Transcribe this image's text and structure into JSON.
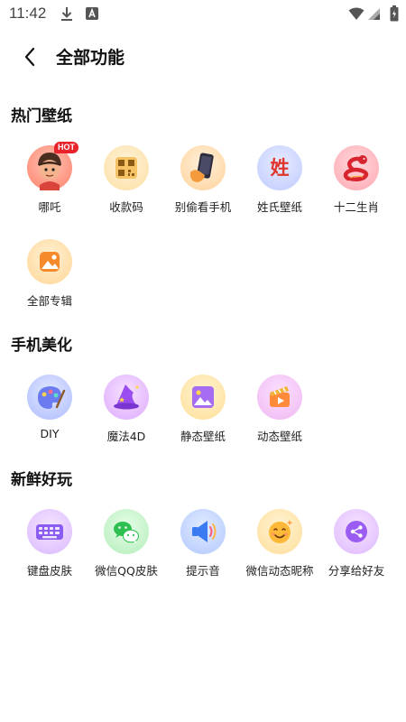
{
  "status_bar": {
    "time": "11:42"
  },
  "header": {
    "title": "全部功能"
  },
  "sections": [
    {
      "title": "热门壁纸"
    },
    {
      "title": "手机美化"
    },
    {
      "title": "新鲜好玩"
    }
  ],
  "hot": {
    "items": [
      {
        "label": "哪吒",
        "badge": "HOT",
        "icon": "nezha-avatar-icon"
      },
      {
        "label": "收款码",
        "icon": "qr-code-icon"
      },
      {
        "label": "别偷看手机",
        "icon": "phone-in-hand-icon"
      },
      {
        "label": "姓氏壁纸",
        "icon": "surname-icon",
        "glyph": "姓"
      },
      {
        "label": "十二生肖",
        "icon": "zodiac-snake-icon"
      },
      {
        "label": "全部专辑",
        "icon": "album-icon"
      }
    ]
  },
  "beauty": {
    "items": [
      {
        "label": "DIY",
        "icon": "palette-icon"
      },
      {
        "label": "魔法4D",
        "icon": "wizard-hat-icon"
      },
      {
        "label": "静态壁纸",
        "icon": "picture-icon"
      },
      {
        "label": "动态壁纸",
        "icon": "clapperboard-icon"
      }
    ]
  },
  "fun": {
    "items": [
      {
        "label": "键盘皮肤",
        "icon": "keyboard-icon"
      },
      {
        "label": "微信QQ皮肤",
        "icon": "wechat-icon"
      },
      {
        "label": "提示音",
        "icon": "speaker-icon"
      },
      {
        "label": "微信动态昵称",
        "icon": "emoji-face-icon"
      },
      {
        "label": "分享给好友",
        "icon": "share-icon"
      }
    ]
  },
  "colors": {
    "hot_badge": "#e8232a",
    "text": "#111111"
  }
}
